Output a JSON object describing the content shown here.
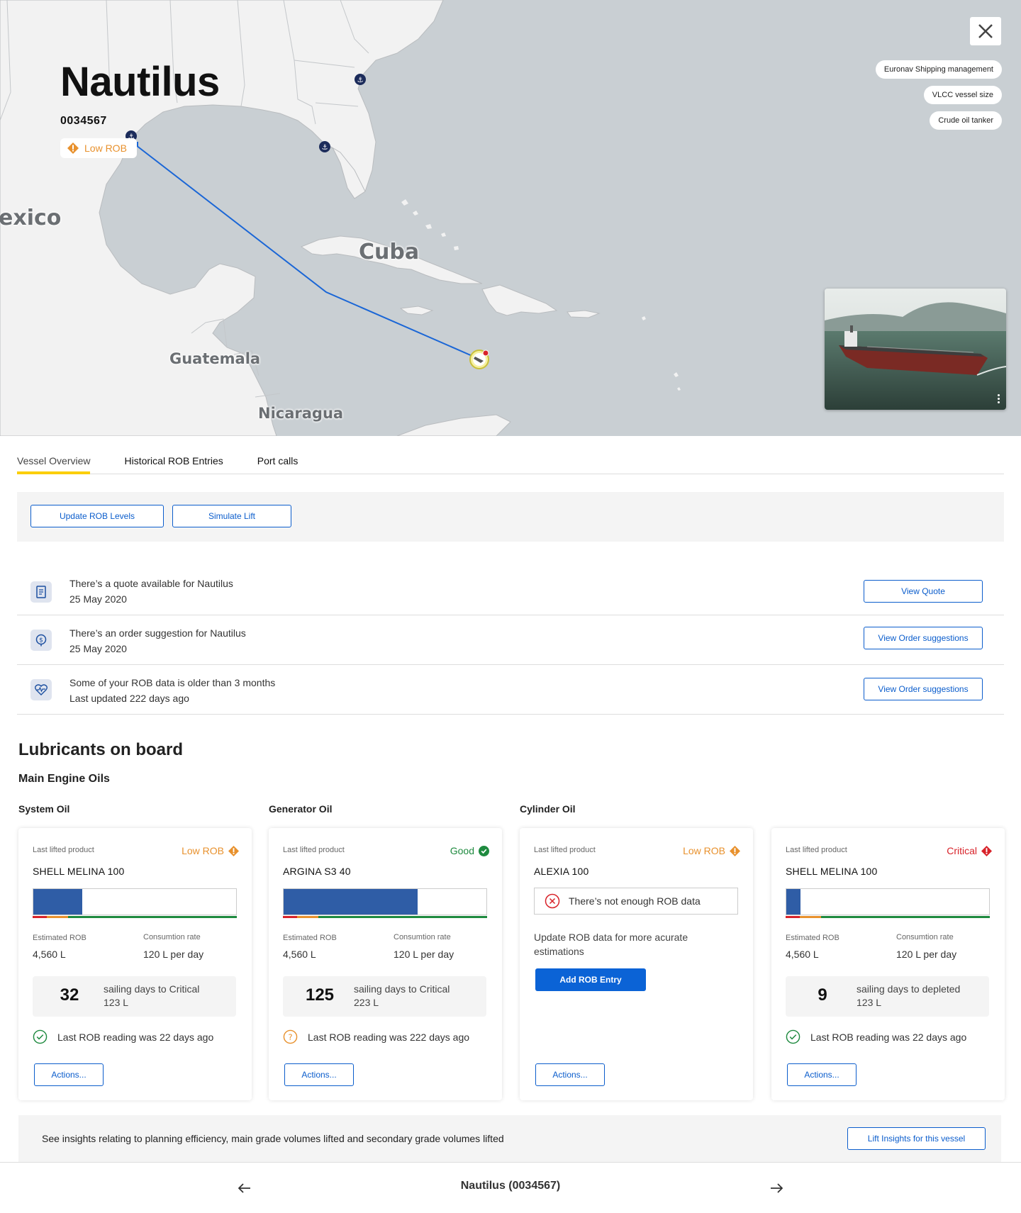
{
  "vessel": {
    "name": "Nautilus",
    "id": "0034567",
    "status": "Low ROB",
    "tags": [
      "Euronav Shipping management",
      "VLCC vessel size",
      "Crude oil tanker"
    ]
  },
  "map": {
    "labels": {
      "mexico": "exico",
      "cuba": "Cuba",
      "guatemala": "Guatemala",
      "nicaragua": "Nicaragua"
    }
  },
  "tabs": [
    "Vessel Overview",
    "Historical ROB Entries",
    "Port calls"
  ],
  "actions": {
    "update": "Update ROB Levels",
    "simulate": "Simulate Lift"
  },
  "notifications": [
    {
      "line1": "There’s a quote available for Nautilus",
      "line2": "25 May 2020",
      "button": "View Quote",
      "icon": "document-icon"
    },
    {
      "line1": "There’s an order suggestion for Nautilus",
      "line2": "25 May 2020",
      "button": "View Order suggestions",
      "icon": "dollar-pin-icon"
    },
    {
      "line1": "Some of your ROB data is older than 3 months",
      "line2": "Last updated 222 days ago",
      "button": "View Order suggestions",
      "icon": "heart-pulse-icon"
    }
  ],
  "lubricants": {
    "title": "Lubricants on board",
    "subtitle": "Main Engine Oils",
    "columns": [
      "System Oil",
      "Generator Oil",
      "Cylinder Oil"
    ],
    "labels": {
      "last_lifted": "Last lifted product",
      "estimated": "Estimated ROB",
      "consumption": "Consumtion rate",
      "actions": "Actions..."
    },
    "cards": [
      {
        "status": "Low ROB",
        "status_color": "#e8912d",
        "product": "SHELL MELINA 100",
        "fill_percent": 24,
        "estimated": "4,560 L",
        "consumption": "120 L per day",
        "days": "32",
        "days_text": "sailing days to Critical",
        "days_sub": "123 L",
        "reading": "Last ROB reading was 22 days ago",
        "reading_icon": "check-circle-icon"
      },
      {
        "status": "Good",
        "status_color": "#1e8a3f",
        "product": "ARGINA S3 40",
        "fill_percent": 66,
        "estimated": "4,560 L",
        "consumption": "120 L per day",
        "days": "125",
        "days_text": "sailing days to Critical",
        "days_sub": "223 L",
        "reading": "Last ROB reading was 222 days ago",
        "reading_icon": "question-circle-icon"
      },
      {
        "status": "Low ROB",
        "status_color": "#e8912d",
        "product": "ALEXIA 100",
        "warning": "There’s not enough ROB data",
        "update_text": "Update ROB data for more acurate estimations",
        "add_button": "Add ROB Entry"
      },
      {
        "status": "Critical",
        "status_color": "#d8232a",
        "product": "SHELL MELINA 100",
        "fill_percent": 7,
        "estimated": "4,560 L",
        "consumption": "120 L per day",
        "days": "9",
        "days_text": "sailing days to depleted",
        "days_sub": "123 L",
        "reading": "Last ROB reading was 22 days ago",
        "reading_icon": "check-circle-icon"
      }
    ]
  },
  "insights": {
    "text": "See insights relating to planning efficiency, main grade volumes lifted and secondary grade volumes lifted",
    "button": "Lift Insights for this vessel"
  },
  "footer": {
    "title": "Nautilus (0034567)"
  },
  "colors": {
    "accent": "#0b5dcc",
    "tab_underline": "#fbce07",
    "route": "#1a66d6",
    "bar_fill": "#2f5da6"
  }
}
